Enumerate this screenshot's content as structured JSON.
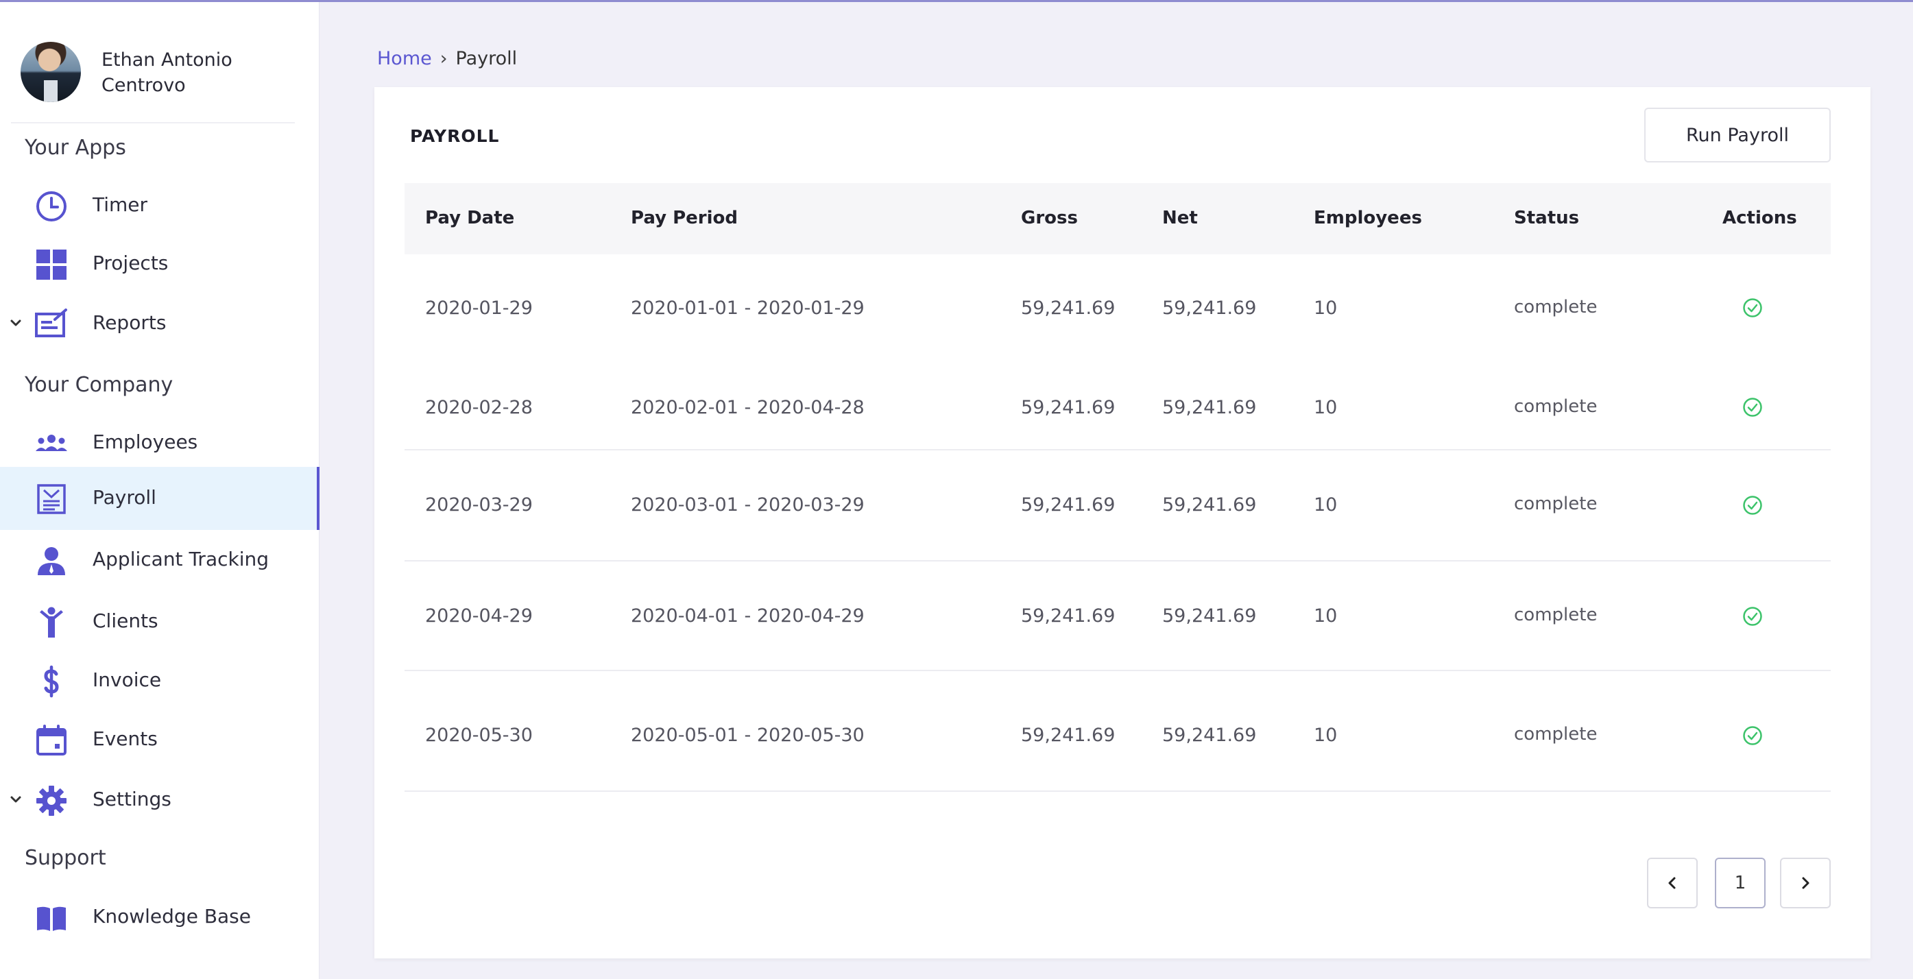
{
  "user": {
    "name": "Ethan Antonio Centrovo"
  },
  "sidebar": {
    "your_apps_title": "Your Apps",
    "your_company_title": "Your Company",
    "support_title": "Support",
    "apps": [
      {
        "label": "Timer",
        "icon": "clock-icon"
      },
      {
        "label": "Projects",
        "icon": "grid-icon"
      },
      {
        "label": "Reports",
        "icon": "report-icon",
        "expandable": true
      }
    ],
    "company": [
      {
        "label": "Employees",
        "icon": "people-icon"
      },
      {
        "label": "Payroll",
        "icon": "payroll-icon",
        "active": true
      },
      {
        "label": "Applicant Tracking",
        "icon": "applicant-icon"
      },
      {
        "label": "Clients",
        "icon": "person-arms-up-icon"
      },
      {
        "label": "Invoice",
        "icon": "dollar-icon"
      },
      {
        "label": "Events",
        "icon": "calendar-icon"
      },
      {
        "label": "Settings",
        "icon": "gear-icon",
        "expandable": true
      }
    ],
    "support": [
      {
        "label": "Knowledge Base",
        "icon": "book-icon"
      }
    ]
  },
  "breadcrumb": {
    "home": "Home",
    "current": "Payroll"
  },
  "payroll": {
    "title": "PAYROLL",
    "run_button": "Run Payroll",
    "columns": [
      "Pay Date",
      "Pay Period",
      "Gross",
      "Net",
      "Employees",
      "Status",
      "Actions"
    ],
    "rows": [
      {
        "pay_date": "2020-01-29",
        "pay_period": "2020-01-01 - 2020-01-29",
        "gross": "59,241.69",
        "net": "59,241.69",
        "employees": "10",
        "status": "complete"
      },
      {
        "pay_date": "2020-02-28",
        "pay_period": "2020-02-01 - 2020-04-28",
        "gross": "59,241.69",
        "net": "59,241.69",
        "employees": "10",
        "status": "complete"
      },
      {
        "pay_date": "2020-03-29",
        "pay_period": "2020-03-01 - 2020-03-29",
        "gross": "59,241.69",
        "net": "59,241.69",
        "employees": "10",
        "status": "complete"
      },
      {
        "pay_date": "2020-04-29",
        "pay_period": "2020-04-01 - 2020-04-29",
        "gross": "59,241.69",
        "net": "59,241.69",
        "employees": "10",
        "status": "complete"
      },
      {
        "pay_date": "2020-05-30",
        "pay_period": "2020-05-01 - 2020-05-30",
        "gross": "59,241.69",
        "net": "59,241.69",
        "employees": "10",
        "status": "complete"
      }
    ]
  },
  "pagination": {
    "current_page": "1"
  },
  "colors": {
    "accent": "#5b57d1",
    "active_bg": "#e7f3fd",
    "success": "#3cc36a"
  }
}
